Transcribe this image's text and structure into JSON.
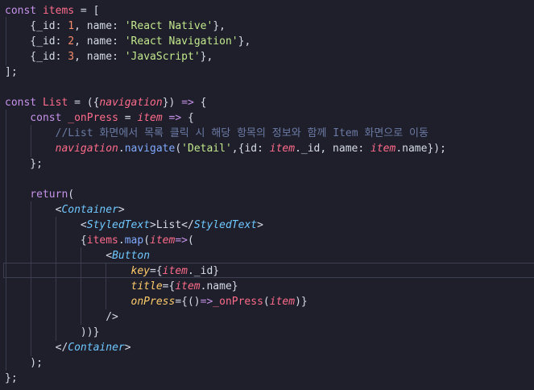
{
  "editor": {
    "background": "#1e1f2a",
    "lines": [
      [
        {
          "t": "const ",
          "c": "kw"
        },
        {
          "t": "items",
          "c": "v"
        },
        {
          "t": " = [",
          "c": "p"
        }
      ],
      [
        {
          "t": "    {",
          "c": "p"
        },
        {
          "t": "_id",
          "c": "p"
        },
        {
          "t": ": ",
          "c": "p"
        },
        {
          "t": "1",
          "c": "n"
        },
        {
          "t": ", name: ",
          "c": "p"
        },
        {
          "t": "'React Native'",
          "c": "s"
        },
        {
          "t": "},",
          "c": "p"
        }
      ],
      [
        {
          "t": "    {",
          "c": "p"
        },
        {
          "t": "_id",
          "c": "p"
        },
        {
          "t": ": ",
          "c": "p"
        },
        {
          "t": "2",
          "c": "n"
        },
        {
          "t": ", name: ",
          "c": "p"
        },
        {
          "t": "'React Navigation'",
          "c": "s"
        },
        {
          "t": "},",
          "c": "p"
        }
      ],
      [
        {
          "t": "    {",
          "c": "p"
        },
        {
          "t": "_id",
          "c": "p"
        },
        {
          "t": ": ",
          "c": "p"
        },
        {
          "t": "3",
          "c": "n"
        },
        {
          "t": ", name: ",
          "c": "p"
        },
        {
          "t": "'JavaScript'",
          "c": "s"
        },
        {
          "t": "},",
          "c": "p"
        }
      ],
      [
        {
          "t": "];",
          "c": "p"
        }
      ],
      [],
      [
        {
          "t": "const ",
          "c": "kw"
        },
        {
          "t": "List",
          "c": "v"
        },
        {
          "t": " = ({",
          "c": "p"
        },
        {
          "t": "navigation",
          "c": "pa"
        },
        {
          "t": "}) ",
          "c": "p"
        },
        {
          "t": "=>",
          "c": "kw"
        },
        {
          "t": " {",
          "c": "p"
        }
      ],
      [
        {
          "t": "    const ",
          "c": "kw"
        },
        {
          "t": "_onPress",
          "c": "v"
        },
        {
          "t": " = ",
          "c": "p"
        },
        {
          "t": "item",
          "c": "pa"
        },
        {
          "t": " ",
          "c": "p"
        },
        {
          "t": "=>",
          "c": "kw"
        },
        {
          "t": " {",
          "c": "p"
        }
      ],
      [
        {
          "t": "        //List 화면에서 목록 클릭 시 해당 항목의 정보와 함께 Item 화면으로 이동",
          "c": "c"
        }
      ],
      [
        {
          "t": "        navigation",
          "c": "pa"
        },
        {
          "t": ".",
          "c": "p"
        },
        {
          "t": "navigate",
          "c": "f"
        },
        {
          "t": "(",
          "c": "p"
        },
        {
          "t": "'Detail'",
          "c": "s"
        },
        {
          "t": ",{id: ",
          "c": "p"
        },
        {
          "t": "item",
          "c": "pa"
        },
        {
          "t": "._id, name: ",
          "c": "p"
        },
        {
          "t": "item",
          "c": "pa"
        },
        {
          "t": ".name});",
          "c": "p"
        }
      ],
      [
        {
          "t": "    };",
          "c": "p"
        }
      ],
      [],
      [
        {
          "t": "    return",
          "c": "kw"
        },
        {
          "t": "(",
          "c": "p"
        }
      ],
      [
        {
          "t": "        <",
          "c": "p"
        },
        {
          "t": "Container",
          "c": "t"
        },
        {
          "t": ">",
          "c": "p"
        }
      ],
      [
        {
          "t": "            <",
          "c": "p"
        },
        {
          "t": "StyledText",
          "c": "t"
        },
        {
          "t": ">List</",
          "c": "p"
        },
        {
          "t": "StyledText",
          "c": "t"
        },
        {
          "t": ">",
          "c": "p"
        }
      ],
      [
        {
          "t": "            {",
          "c": "p"
        },
        {
          "t": "items",
          "c": "v"
        },
        {
          "t": ".",
          "c": "p"
        },
        {
          "t": "map",
          "c": "f"
        },
        {
          "t": "(",
          "c": "p"
        },
        {
          "t": "item",
          "c": "pa"
        },
        {
          "t": "=>",
          "c": "kw"
        },
        {
          "t": "(",
          "c": "p"
        }
      ],
      [
        {
          "t": "                <",
          "c": "p"
        },
        {
          "t": "Button",
          "c": "t"
        }
      ],
      [
        {
          "t": "                    key",
          "c": "a"
        },
        {
          "t": "={",
          "c": "p"
        },
        {
          "t": "item",
          "c": "pa"
        },
        {
          "t": "._id}",
          "c": "p"
        }
      ],
      [
        {
          "t": "                    title",
          "c": "a"
        },
        {
          "t": "={",
          "c": "p"
        },
        {
          "t": "item",
          "c": "pa"
        },
        {
          "t": ".name}",
          "c": "p"
        }
      ],
      [
        {
          "t": "                    onPress",
          "c": "a"
        },
        {
          "t": "={()",
          "c": "p"
        },
        {
          "t": "=>",
          "c": "kw"
        },
        {
          "t": "_onPress",
          "c": "v"
        },
        {
          "t": "(",
          "c": "p"
        },
        {
          "t": "item",
          "c": "pa"
        },
        {
          "t": ")}",
          "c": "p"
        }
      ],
      [
        {
          "t": "                />",
          "c": "p"
        }
      ],
      [
        {
          "t": "            ))}",
          "c": "p"
        }
      ],
      [
        {
          "t": "        </",
          "c": "p"
        },
        {
          "t": "Container",
          "c": "t"
        },
        {
          "t": ">",
          "c": "p"
        }
      ],
      [
        {
          "t": "    );",
          "c": "p"
        }
      ],
      [
        {
          "t": "};",
          "c": "p"
        }
      ]
    ]
  }
}
